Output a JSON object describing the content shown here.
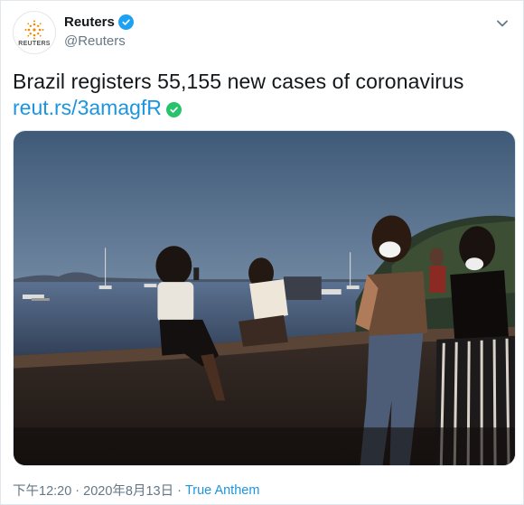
{
  "account": {
    "display_name": "Reuters",
    "handle": "@Reuters",
    "avatar_text": "REUTERS",
    "verified": true
  },
  "tweet": {
    "text": "Brazil registers 55,155 new cases of coronavirus",
    "link": "reut.rs/3amagfR",
    "link_emoji": "check-mark-button-icon"
  },
  "footer": {
    "time": "下午12:20",
    "separator": "·",
    "date": "2020年8月13日",
    "source": "True Anthem"
  },
  "colors": {
    "link": "#1b95e0",
    "verified": "#1da1f2",
    "secondary_text": "#657786"
  }
}
